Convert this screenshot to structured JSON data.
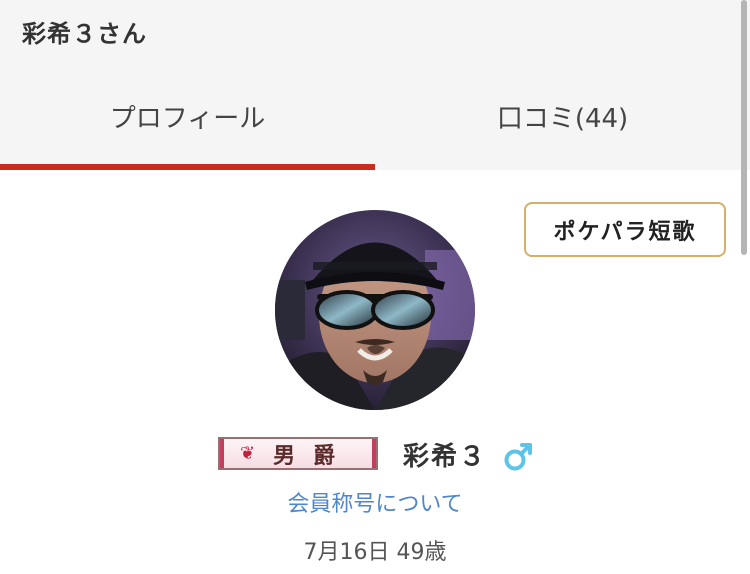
{
  "header": {
    "title": "彩希３さん"
  },
  "tabs": [
    {
      "label": "プロフィール",
      "active": true
    },
    {
      "label": "口コミ(44)",
      "active": false
    }
  ],
  "tanka_button": {
    "label": "ポケパラ短歌"
  },
  "profile": {
    "rank_badge": {
      "emblem": "❦",
      "title": "男爵"
    },
    "name": "彩希３",
    "gender_icon": "male-symbol",
    "member_title_link": "会員称号について",
    "birthday_age": "7月16日 49歳"
  },
  "colors": {
    "active_tab_indicator": "#cc2b22",
    "tanka_border": "#d4b06a",
    "link": "#4f87c9",
    "gender_male": "#5ec3e8"
  }
}
